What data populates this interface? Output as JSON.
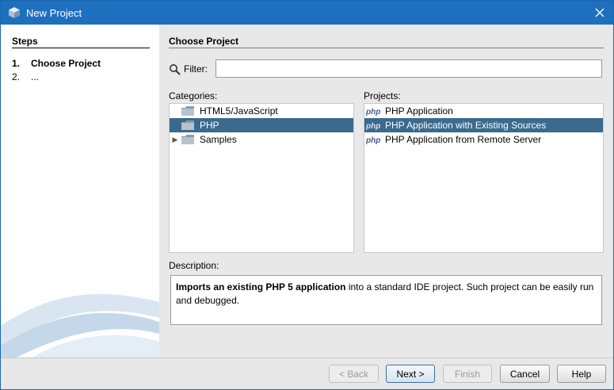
{
  "window": {
    "title": "New Project"
  },
  "steps": {
    "title": "Steps",
    "items": [
      {
        "num": "1.",
        "label": "Choose Project",
        "active": true
      },
      {
        "num": "2.",
        "label": "...",
        "active": false
      }
    ]
  },
  "main": {
    "section_title": "Choose Project",
    "filter": {
      "label": "Filter:",
      "value": ""
    },
    "categories": {
      "label": "Categories:",
      "items": [
        {
          "label": "HTML5/JavaScript",
          "expandable": false,
          "selected": false
        },
        {
          "label": "PHP",
          "expandable": false,
          "selected": true
        },
        {
          "label": "Samples",
          "expandable": true,
          "selected": false
        }
      ]
    },
    "projects": {
      "label": "Projects:",
      "items": [
        {
          "label": "PHP Application",
          "selected": false
        },
        {
          "label": "PHP Application with Existing Sources",
          "selected": true
        },
        {
          "label": "PHP Application from Remote Server",
          "selected": false
        }
      ]
    },
    "description": {
      "label": "Description:",
      "bold": "Imports an existing PHP 5 application",
      "rest": " into a standard IDE project. Such project can be easily run and debugged."
    }
  },
  "buttons": {
    "back": "< Back",
    "next": "Next >",
    "finish": "Finish",
    "cancel": "Cancel",
    "help": "Help"
  },
  "colors": {
    "titlebar": "#1f6fbf",
    "selection": "#3a6a8e"
  }
}
